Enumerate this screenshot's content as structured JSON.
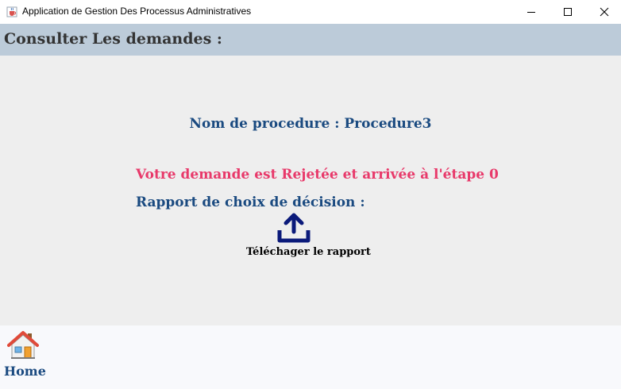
{
  "window": {
    "title": "Application de Gestion Des Processus Administratives"
  },
  "header": {
    "title": "Consulter Les demandes :"
  },
  "main": {
    "procedure_line": "Nom de procedure : Procedure3",
    "status_line": "Votre demande est Rejetée et arrivée à l'étape 0",
    "report_label": "Rapport de choix de décision :",
    "download_label": "Téléchager le rapport"
  },
  "footer": {
    "home_label": "Home"
  },
  "icons": {
    "app": "java-cup-icon",
    "minimize": "minimize-icon",
    "maximize": "maximize-icon",
    "close": "close-icon",
    "upload": "upload-icon",
    "home": "home-icon"
  },
  "colors": {
    "header_bg": "#bccbd9",
    "content_bg": "#eeeeee",
    "footer_bg": "#f8f9fc",
    "primary_text": "#1a4a80",
    "status_text": "#e8396a",
    "upload_icon": "#0b1a7a"
  }
}
